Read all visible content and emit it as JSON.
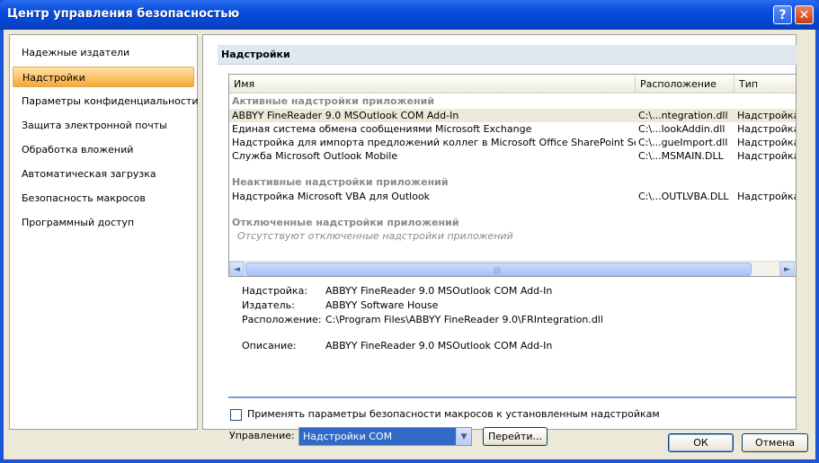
{
  "window": {
    "title": "Центр управления безопасностью",
    "help_glyph": "?",
    "close_glyph": "✕"
  },
  "sidebar": {
    "items": [
      {
        "label": "Надежные издатели",
        "selected": false
      },
      {
        "label": "Надстройки",
        "selected": true
      },
      {
        "label": "Параметры конфиденциальности",
        "selected": false
      },
      {
        "label": "Защита электронной почты",
        "selected": false
      },
      {
        "label": "Обработка вложений",
        "selected": false
      },
      {
        "label": "Автоматическая загрузка",
        "selected": false
      },
      {
        "label": "Безопасность макросов",
        "selected": false
      },
      {
        "label": "Программный доступ",
        "selected": false
      }
    ]
  },
  "main": {
    "header": "Надстройки",
    "list": {
      "columns": [
        "Имя",
        "Расположение",
        "Тип"
      ],
      "groups": [
        {
          "title": "Активные надстройки приложений",
          "rows": [
            {
              "name": "ABBYY FineReader 9.0 MSOutlook COM Add-In",
              "location": "C:\\...ntegration.dll",
              "type": "Надстройка",
              "selected": true
            },
            {
              "name": "Единая система обмена сообщениями Microsoft Exchange",
              "location": "C:\\...lookAddin.dll",
              "type": "Надстройка",
              "selected": false
            },
            {
              "name": "Надстройка для импорта предложений коллег в Microsoft Office SharePoint Server",
              "location": "C:\\...gueImport.dll",
              "type": "Надстройка",
              "selected": false
            },
            {
              "name": "Служба Microsoft Outlook Mobile",
              "location": "C:\\...MSMAIN.DLL",
              "type": "Надстройка",
              "selected": false
            }
          ]
        },
        {
          "title": "Неактивные надстройки приложений",
          "rows": [
            {
              "name": "Надстройка Microsoft VBA для Outlook",
              "location": "C:\\...OUTLVBA.DLL",
              "type": "Надстройка",
              "selected": false
            }
          ]
        },
        {
          "title": "Отключенные надстройки приложений",
          "empty_text": "Отсутствуют отключенные надстройки приложений",
          "rows": []
        }
      ],
      "scroll_left_glyph": "◄",
      "scroll_right_glyph": "►",
      "scroll_grip_glyph": "|||"
    },
    "details": {
      "addin_label": "Надстройка:",
      "addin_value": "ABBYY FineReader 9.0 MSOutlook COM Add-In",
      "publisher_label": "Издатель:",
      "publisher_value": "ABBYY Software House",
      "location_label": "Расположение:",
      "location_value": "C:\\Program Files\\ABBYY FineReader 9.0\\FRIntegration.dll",
      "description_label": "Описание:",
      "description_value": "ABBYY FineReader 9.0 MSOutlook COM Add-In"
    },
    "macro_checkbox": {
      "label": "Применять параметры безопасности макросов к установленным надстройкам",
      "checked": false
    },
    "manage": {
      "label": "Управление:",
      "selected": "Надстройки COM",
      "arrow_glyph": "▼",
      "go_label": "Перейти..."
    }
  },
  "footer": {
    "ok_label": "ОК",
    "cancel_label": "Отмена"
  },
  "colors": {
    "title_bar": "#0a4fe0",
    "selection": "#fbc365",
    "combo_selected": "#316ac5",
    "dialog_bg": "#ece9d8"
  }
}
